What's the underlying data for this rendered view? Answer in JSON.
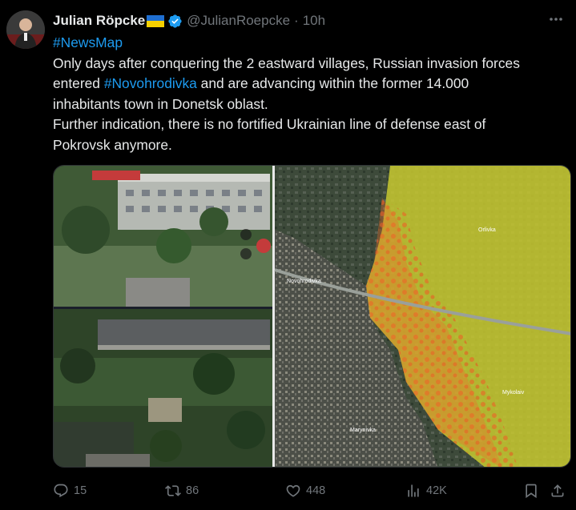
{
  "author": {
    "name": "Julian Röpcke",
    "handle": "@JulianRoepcke",
    "separator": "·",
    "time": "10h"
  },
  "flag_colors": {
    "top": "#1f6fd1",
    "bottom": "#f5d000"
  },
  "accent_color": "#1d9bf0",
  "text": {
    "hashtag": "#NewsMap",
    "line1": "Only days after conquering the 2 eastward villages, Russian invasion forces",
    "line2_pre": "entered ",
    "line2_tag": "#Novohrodivka",
    "line2_post": " and are advancing within the former 14.000",
    "line3": "inhabitants town in Donetsk oblast.",
    "line4": "Further indication, there is no fortified Ukrainian line of defense east of",
    "line5": "Pokrovsk anymore."
  },
  "media": {
    "map_labels": {
      "orlivka": "Orlivka",
      "novohrodivka": "Novohrodivka",
      "mykolaiv": "Mykolaiv",
      "marynivka": "Marynivka"
    }
  },
  "actions": {
    "replies": "15",
    "reposts": "86",
    "likes": "448",
    "views": "42K"
  },
  "icons": {
    "more": "more-icon",
    "verified": "verified-badge-icon",
    "reply": "reply-icon",
    "repost": "repost-icon",
    "like": "heart-icon",
    "views": "views-icon",
    "bookmark": "bookmark-icon",
    "share": "share-icon"
  }
}
